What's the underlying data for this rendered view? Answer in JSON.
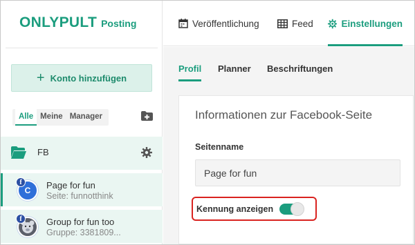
{
  "brand": {
    "name": "ONLYPULT",
    "product": "Posting",
    "accent": "#1b9d7e"
  },
  "sidebar": {
    "add_account_label": "Konto hinzufügen",
    "filters": [
      {
        "label": "Alle",
        "active": true
      },
      {
        "label": "Meine",
        "active": false
      },
      {
        "label": "Manager",
        "active": false
      }
    ],
    "group": {
      "label": "FB"
    },
    "accounts": [
      {
        "name": "Page for fun",
        "subtitle": "Seite: funnotthink",
        "avatar_letter": "C",
        "network": "facebook"
      },
      {
        "name": "Group for fun too",
        "subtitle": "Gruppe: 3381809...",
        "avatar_letter": "",
        "network": "facebook"
      }
    ]
  },
  "topnav": {
    "items": [
      {
        "label": "Veröffentlichung",
        "icon": "calendar-icon",
        "active": false
      },
      {
        "label": "Feed",
        "icon": "grid-icon",
        "active": false
      },
      {
        "label": "Einstellungen",
        "icon": "gear-icon",
        "active": true
      }
    ]
  },
  "subtabs": [
    {
      "label": "Profil",
      "active": true
    },
    {
      "label": "Planner",
      "active": false
    },
    {
      "label": "Beschriftungen",
      "active": false
    }
  ],
  "card": {
    "title": "Informationen zur Facebook-Seite",
    "field_label": "Seitenname",
    "field_value": "Page for fun",
    "toggle_label": "Kennung anzeigen",
    "toggle_on": true,
    "highlight_color": "#d9221f"
  }
}
